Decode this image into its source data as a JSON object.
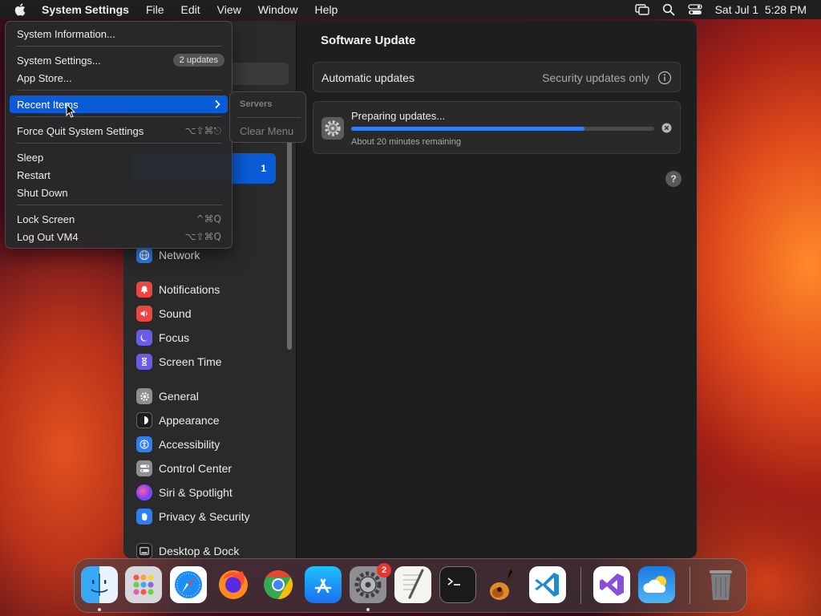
{
  "menubar": {
    "app_name": "System Settings",
    "items": [
      "File",
      "Edit",
      "View",
      "Window",
      "Help"
    ],
    "clock": "Sat Jul 1  5:28 PM"
  },
  "apple_menu": {
    "system_information": "System Information...",
    "system_settings": "System Settings...",
    "updates_badge": "2 updates",
    "app_store": "App Store...",
    "recent_items": "Recent Items",
    "force_quit": "Force Quit System Settings",
    "force_quit_shortcut": "⌥⇧⌘⎋",
    "sleep": "Sleep",
    "restart": "Restart",
    "shut_down": "Shut Down",
    "lock_screen": "Lock Screen",
    "lock_shortcut": "^⌘Q",
    "log_out": "Log Out VM4",
    "log_out_shortcut": "⌥⇧⌘Q"
  },
  "submenu": {
    "header": "Servers",
    "clear": "Clear Menu"
  },
  "sidebar": {
    "selected_badge": "1",
    "items": [
      {
        "label": "Network",
        "color": "#2f7ff2"
      },
      {
        "label": "Notifications",
        "color": "#e8463f"
      },
      {
        "label": "Sound",
        "color": "#e8463f"
      },
      {
        "label": "Focus",
        "color": "#6b5ce7"
      },
      {
        "label": "Screen Time",
        "color": "#6b5ce7"
      },
      {
        "label": "General",
        "color": "#8e8e93"
      },
      {
        "label": "Appearance",
        "color": "#1c1c1e"
      },
      {
        "label": "Accessibility",
        "color": "#2f7ff2"
      },
      {
        "label": "Control Center",
        "color": "#8e8e93"
      },
      {
        "label": "Siri & Spotlight",
        "color": "#b04fe0"
      },
      {
        "label": "Privacy & Security",
        "color": "#2f7ff2"
      },
      {
        "label": "Desktop & Dock",
        "color": "#1c1c1e"
      }
    ]
  },
  "main": {
    "title": "Software Update",
    "automatic_label": "Automatic updates",
    "automatic_value": "Security updates only",
    "preparing": "Preparing updates...",
    "progress": 0.77,
    "remaining": "About 20 minutes remaining",
    "help": "?"
  },
  "dock": {
    "settings_badge": "2"
  }
}
